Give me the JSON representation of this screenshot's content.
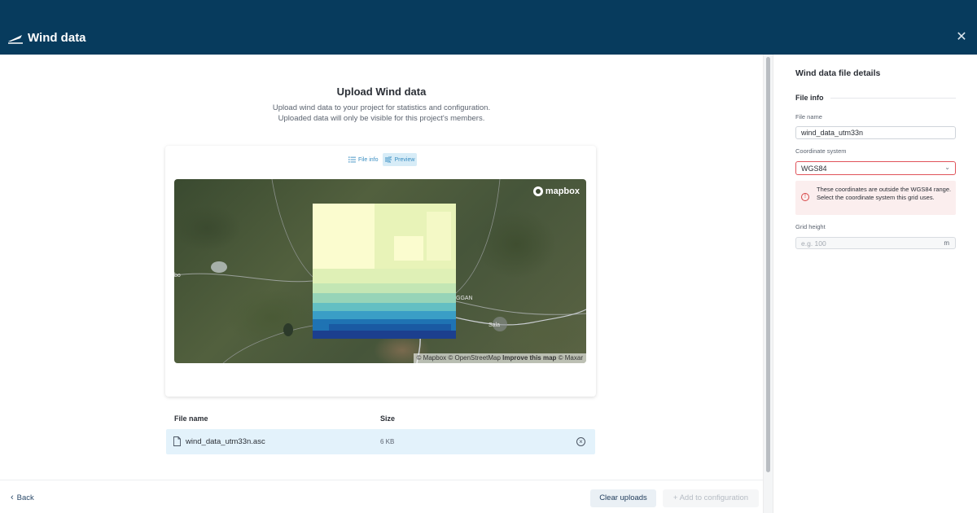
{
  "header": {
    "title": "Wind data",
    "close_icon": "close-icon"
  },
  "upload": {
    "title": "Upload Wind data",
    "desc_line1": "Upload wind data to your project for statistics and configuration.",
    "desc_line2": "Uploaded data will only be visible for this project's members."
  },
  "preview": {
    "tabs": [
      {
        "label": "File info",
        "icon": "list-icon"
      },
      {
        "label": "Preview",
        "icon": "wind-icon",
        "active": true
      }
    ],
    "map": {
      "logo": "mapbox",
      "attribution_plain": "© Mapbox © OpenStreetMap ",
      "attribution_link": "Improve this map",
      "attribution_tail": " © Maxar",
      "place_bo": "bo",
      "place_sala": "Sala",
      "place_ggan": "GGAN"
    }
  },
  "files": {
    "columns": [
      "File name",
      "Size"
    ],
    "rows": [
      {
        "name": "wind_data_utm33n.asc",
        "size": "6 KB"
      }
    ]
  },
  "footer": {
    "back_label": "Back",
    "clear_label": "Clear uploads",
    "add_label": "Add to configuration"
  },
  "panel": {
    "title": "Wind data file details",
    "section": "File info",
    "file_name_label": "File name",
    "file_name_value": "wind_data_utm33n",
    "coord_label": "Coordinate system",
    "coord_value": "WGS84",
    "alert_text": "These coordinates are outside the WGS84 range. Select the coordinate system this grid uses.",
    "grid_height_label": "Grid height",
    "grid_height_placeholder": "e.g. 100",
    "grid_height_unit": "m"
  },
  "colors": {
    "header_bg": "#073b5d",
    "accent": "#3a8ec2",
    "error": "#e0535a",
    "row_highlight": "#e3f2fb"
  }
}
